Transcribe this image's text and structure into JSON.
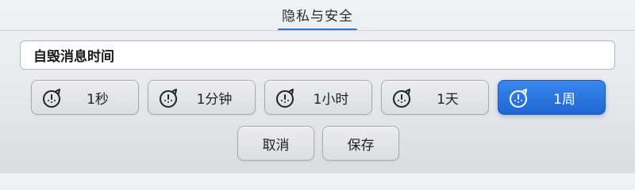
{
  "header": {
    "tab_label": "隐私与安全"
  },
  "field": {
    "value": "自毁消息时间"
  },
  "options": [
    {
      "label": "1秒",
      "icon": "timer-icon",
      "selected": false
    },
    {
      "label": "1分钟",
      "icon": "timer-icon",
      "selected": false
    },
    {
      "label": "1小时",
      "icon": "timer-icon",
      "selected": false
    },
    {
      "label": "1天",
      "icon": "timer-icon",
      "selected": false
    },
    {
      "label": "1周",
      "icon": "timer-icon",
      "selected": true
    }
  ],
  "actions": {
    "cancel_label": "取消",
    "save_label": "保存"
  },
  "colors": {
    "accent": "#2f73d9",
    "selected_bg": "#2a78e4"
  }
}
